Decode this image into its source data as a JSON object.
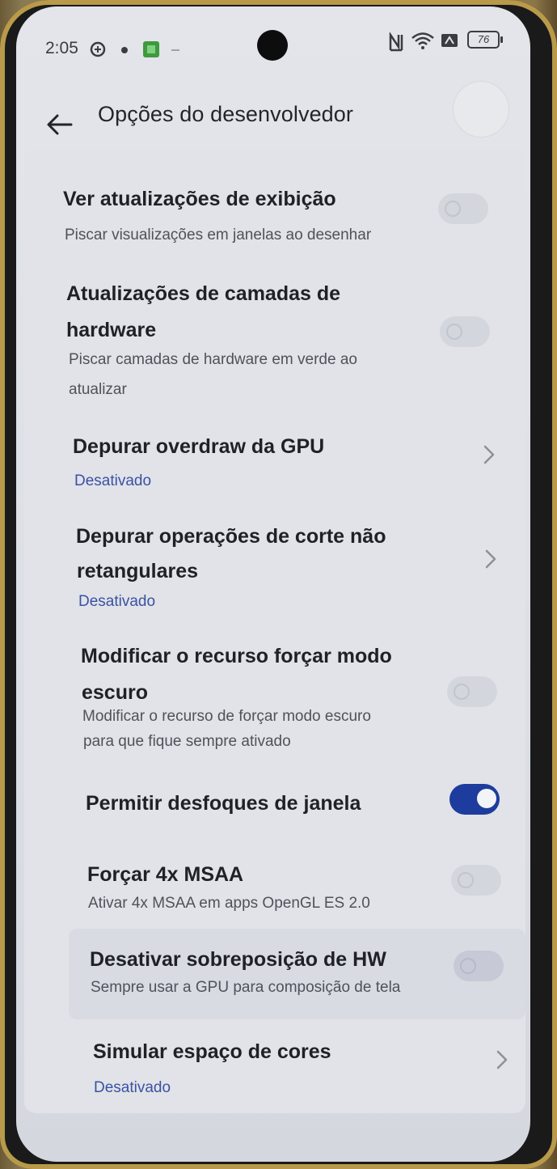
{
  "status_bar": {
    "time": "2:05",
    "battery": "76",
    "icons": [
      "nfc-icon",
      "wifi-icon",
      "sim-icon",
      "battery-icon"
    ]
  },
  "app_bar": {
    "title": "Opções do desenvolvedor",
    "back_icon": "arrow-left-icon"
  },
  "settings": [
    {
      "title": "Ver atualizações de exibição",
      "subtitle": "Piscar visualizações em janelas ao desenhar",
      "control": "toggle",
      "checked": false
    },
    {
      "title_line1": "Atualizações de camadas de",
      "title_line2": "hardware",
      "subtitle_line1": "Piscar camadas de hardware em verde ao",
      "subtitle_line2": "atualizar",
      "control": "toggle",
      "checked": false
    },
    {
      "title": "Depurar overdraw da GPU",
      "status": "Desativado",
      "control": "chevron"
    },
    {
      "title_line1": "Depurar operações de corte não",
      "title_line2": "retangulares",
      "status": "Desativado",
      "control": "chevron"
    },
    {
      "title_line1": "Modificar o recurso forçar modo",
      "title_line2": "escuro",
      "subtitle_line1": "Modificar o recurso de forçar modo escuro",
      "subtitle_line2": "para que fique sempre ativado",
      "control": "toggle",
      "checked": false
    },
    {
      "title": "Permitir desfoques de janela",
      "control": "toggle",
      "checked": true
    },
    {
      "title": "Forçar 4x MSAA",
      "subtitle": "Ativar 4x MSAA em apps OpenGL ES 2.0",
      "control": "toggle",
      "checked": false
    },
    {
      "title": "Desativar sobreposição de HW",
      "subtitle": "Sempre usar a GPU para composição de tela",
      "control": "toggle",
      "checked": false
    },
    {
      "title": "Simular espaço de cores",
      "status": "Desativado",
      "control": "chevron"
    }
  ],
  "colors": {
    "accent": "#1d3c9d",
    "status_text": "#3a52a4",
    "background": "#e1e3e8"
  }
}
